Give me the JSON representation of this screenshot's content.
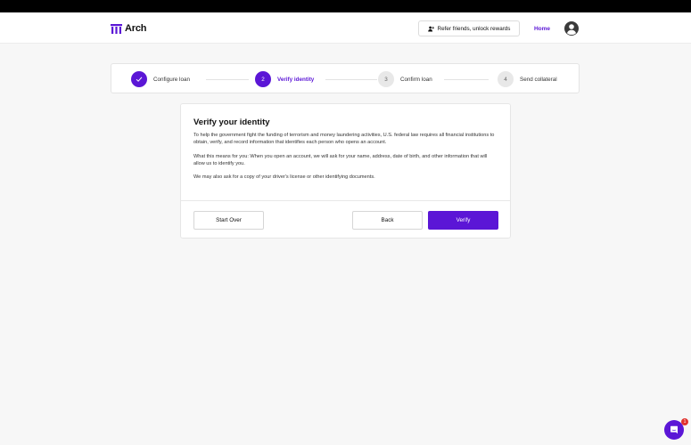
{
  "brand": {
    "name": "Arch",
    "accent": "#5b16d6"
  },
  "header": {
    "refer_label": "Refer friends, unlock rewards",
    "home_label": "Home"
  },
  "stepper": {
    "steps": [
      {
        "number": "",
        "label": "Configure loan",
        "state": "done"
      },
      {
        "number": "2",
        "label": "Verify identity",
        "state": "active"
      },
      {
        "number": "3",
        "label": "Confirm loan",
        "state": "todo"
      },
      {
        "number": "4",
        "label": "Send collateral",
        "state": "todo"
      }
    ]
  },
  "card": {
    "title": "Verify your identity",
    "paragraphs": [
      "To help the government fight the funding of terrorism and money laundering activities, U.S. federal law requires all financial institutions to obtain, verify, and record information that identifies each person who opens an account.",
      "What this means for you: When you open an account, we will ask for your name, address, date of birth, and other information that will allow us to identify you.",
      "We may also ask for a copy of your driver's license or other identifying documents."
    ],
    "buttons": {
      "start_over": "Start Over",
      "back": "Back",
      "verify": "Verify"
    }
  },
  "chat": {
    "badge": "1"
  }
}
